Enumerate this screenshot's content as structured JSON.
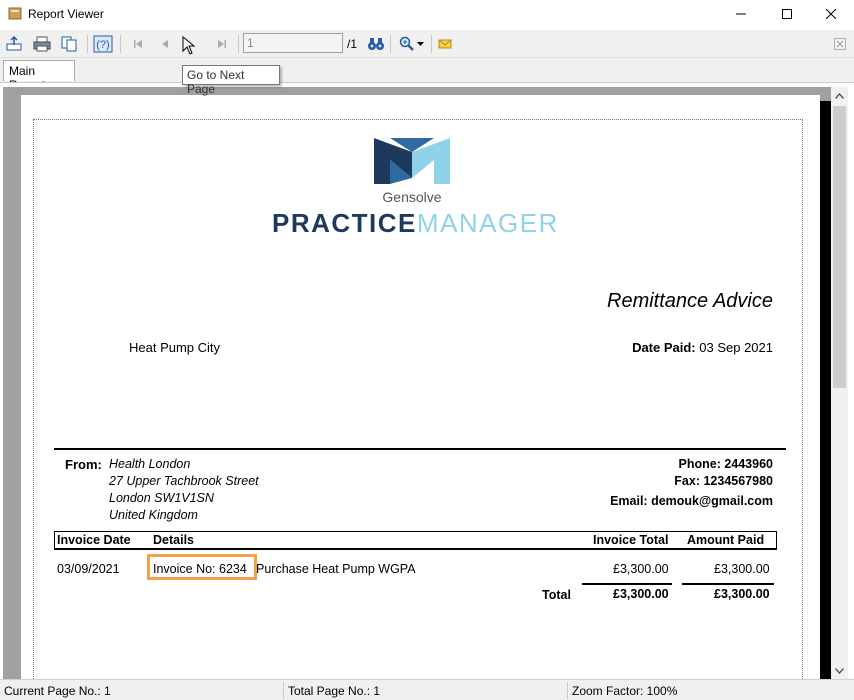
{
  "window": {
    "title": "Report Viewer"
  },
  "toolbar": {
    "page_value": "1",
    "page_total": "/1",
    "tooltip": "Go to Next Page"
  },
  "tabs": [
    {
      "label": "Main Report"
    }
  ],
  "report": {
    "logo": {
      "brand_small": "Gensolve",
      "brand_dark": "PRACTICE",
      "brand_light": "MANAGER"
    },
    "title": "Remittance Advice",
    "company": "Heat Pump City",
    "date_paid_label": "Date Paid:",
    "date_paid_value": "03 Sep 2021",
    "from_label": "From:",
    "from_lines": [
      "Health London",
      "27 Upper Tachbrook Street",
      "London SW1V1SN",
      "United Kingdom"
    ],
    "phone": "Phone: 2443960",
    "fax": "Fax: 1234567980",
    "email": "Email: demouk@gmail.com",
    "table": {
      "headers": [
        "Invoice Date",
        "Details",
        "Invoice Total",
        "Amount Paid"
      ],
      "rows": [
        {
          "date": "03/09/2021",
          "details_invoice": "Invoice No: 6234",
          "details_rest": "Purchase Heat Pump WGPA",
          "invoice_total": "£3,300.00",
          "amount_paid": "£3,300.00"
        }
      ],
      "total_label": "Total",
      "total_invoice": "£3,300.00",
      "total_paid": "£3,300.00"
    }
  },
  "status": {
    "current_page": "Current Page No.: 1",
    "total_page": "Total Page No.: 1",
    "zoom": "Zoom Factor: 100%"
  },
  "colors": {
    "highlight": "#f5a04a",
    "logo_dark": "#1d3a5c",
    "logo_light": "#8fd3e8"
  }
}
